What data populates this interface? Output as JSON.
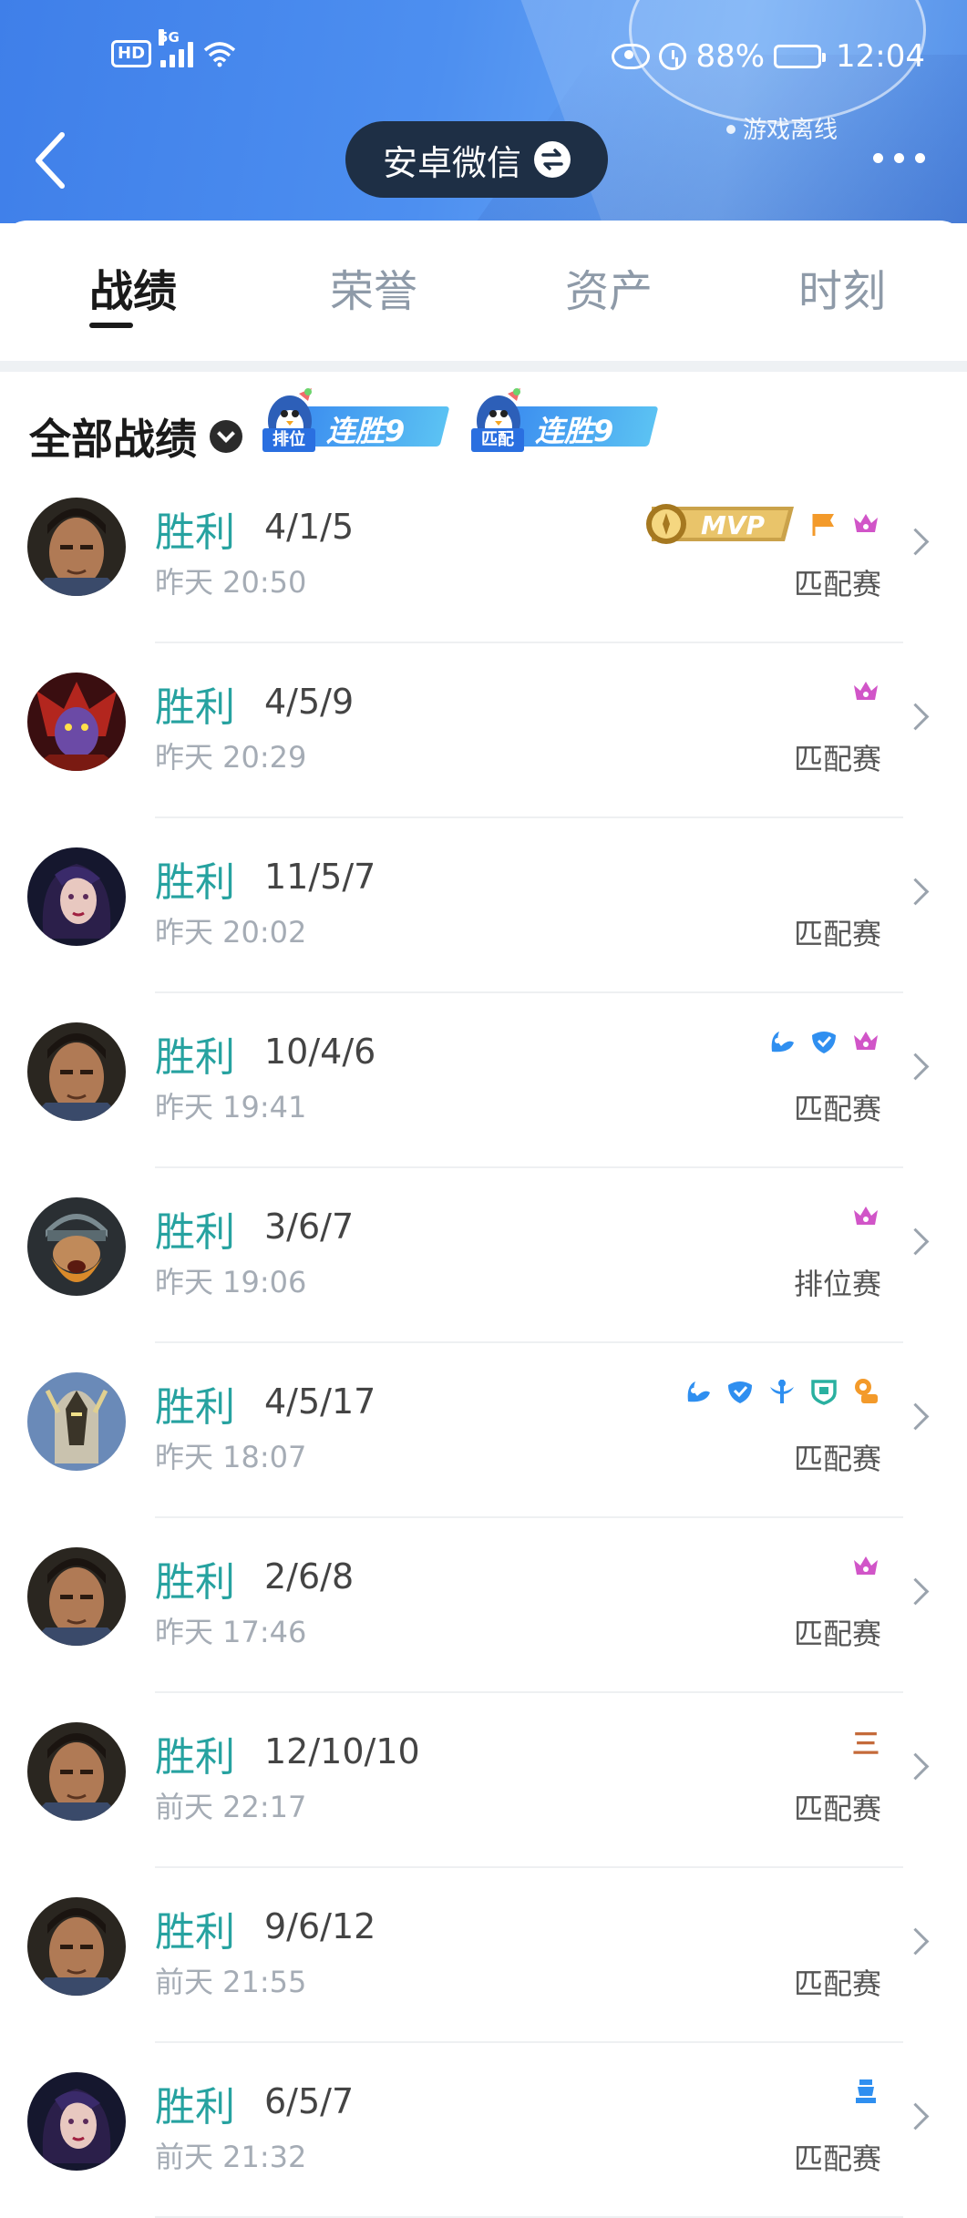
{
  "status_bar": {
    "network": "5G",
    "hd_label": "HD",
    "battery": "88%",
    "battery_level": 0.88,
    "time": "12:04"
  },
  "header": {
    "account_switch_label": "安卓微信",
    "game_status": "游戏离线"
  },
  "tabs": [
    {
      "label": "战绩",
      "active": true
    },
    {
      "label": "荣誉",
      "active": false
    },
    {
      "label": "资产",
      "active": false
    },
    {
      "label": "时刻",
      "active": false
    }
  ],
  "filter": {
    "title": "全部战绩",
    "streaks": [
      {
        "mode": "排位",
        "text": "连胜9"
      },
      {
        "mode": "匹配",
        "text": "连胜9"
      }
    ]
  },
  "colors": {
    "win": "#26a2a0",
    "header_blue": "#4a8ae8",
    "badge_pink": "#d155c8",
    "badge_orange": "#f39a2a",
    "badge_blue": "#2f8ff0"
  },
  "matches": [
    {
      "result": "胜利",
      "kda": "4/1/5",
      "time": "昨天 20:50",
      "mode": "匹配赛",
      "hero": "hero-warrior",
      "badges": [
        "mvp-badge",
        "flag-icon",
        "crown-icon"
      ],
      "mvp_text": "MVP"
    },
    {
      "result": "胜利",
      "kda": "4/5/9",
      "time": "昨天 20:29",
      "mode": "匹配赛",
      "hero": "hero-demon",
      "badges": [
        "crown-icon"
      ]
    },
    {
      "result": "胜利",
      "kda": "11/5/7",
      "time": "昨天 20:02",
      "mode": "匹配赛",
      "hero": "hero-sorceress",
      "badges": []
    },
    {
      "result": "胜利",
      "kda": "10/4/6",
      "time": "昨天 19:41",
      "mode": "匹配赛",
      "hero": "hero-warrior",
      "badges": [
        "sword-icon",
        "shield-icon",
        "crown-icon"
      ]
    },
    {
      "result": "胜利",
      "kda": "3/6/7",
      "time": "昨天 19:06",
      "mode": "排位赛",
      "hero": "hero-bearded",
      "badges": [
        "crown-icon"
      ]
    },
    {
      "result": "胜利",
      "kda": "4/5/17",
      "time": "昨天 18:07",
      "mode": "匹配赛",
      "hero": "hero-knight",
      "badges": [
        "sword-icon",
        "shield-icon",
        "support-icon",
        "guard-icon",
        "coin-icon"
      ]
    },
    {
      "result": "胜利",
      "kda": "2/6/8",
      "time": "昨天 17:46",
      "mode": "匹配赛",
      "hero": "hero-warrior",
      "badges": [
        "crown-icon"
      ]
    },
    {
      "result": "胜利",
      "kda": "12/10/10",
      "time": "前天 22:17",
      "mode": "匹配赛",
      "hero": "hero-warrior",
      "badges": [
        "triple-kill-icon"
      ],
      "triple_text": "三"
    },
    {
      "result": "胜利",
      "kda": "9/6/12",
      "time": "前天 21:55",
      "mode": "匹配赛",
      "hero": "hero-warrior",
      "badges": []
    },
    {
      "result": "胜利",
      "kda": "6/5/7",
      "time": "前天 21:32",
      "mode": "匹配赛",
      "hero": "hero-sorceress",
      "badges": [
        "tower-icon"
      ]
    }
  ]
}
